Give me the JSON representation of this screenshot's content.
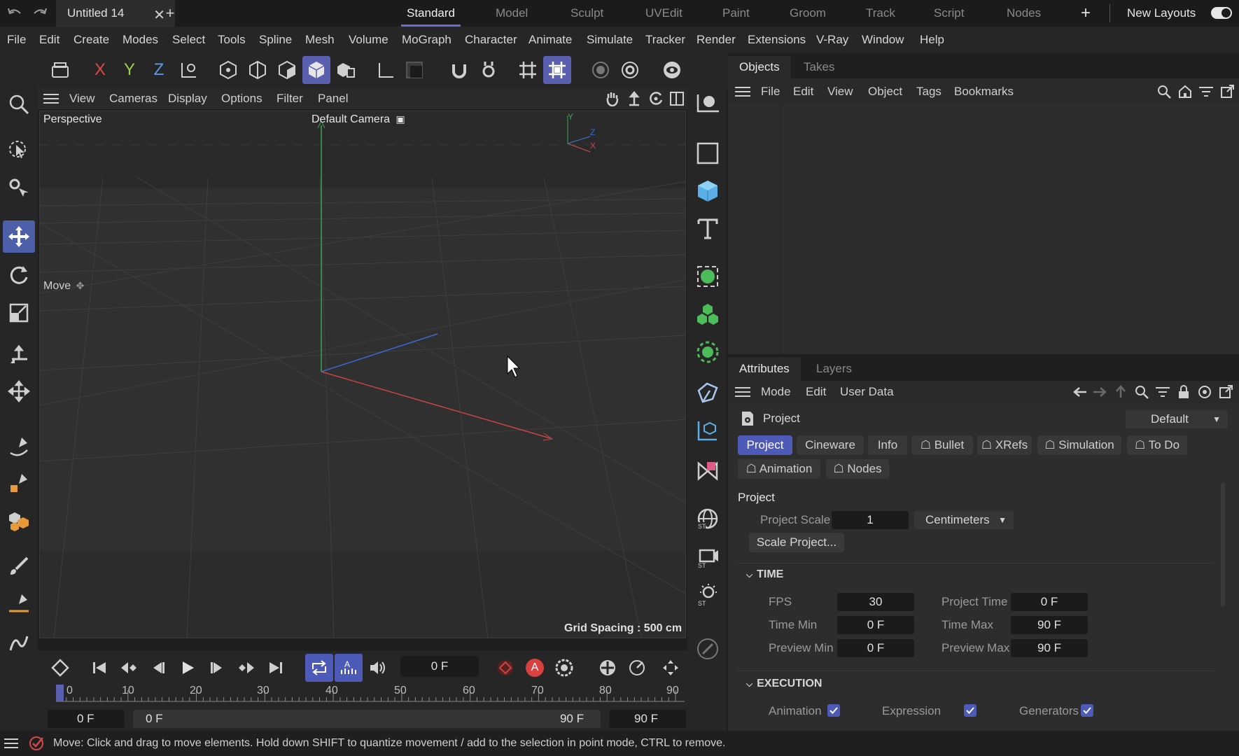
{
  "document": {
    "title": "Untitled 14"
  },
  "layouts": {
    "items": [
      "Standard",
      "Model",
      "Sculpt",
      "UVEdit",
      "Paint",
      "Groom",
      "Track",
      "Script",
      "Nodes"
    ],
    "active": "Standard",
    "new_layouts_label": "New Layouts"
  },
  "menubar": [
    "File",
    "Edit",
    "Create",
    "Modes",
    "Select",
    "Tools",
    "Spline",
    "Mesh",
    "Volume",
    "MoGraph",
    "Character",
    "Animate",
    "Simulate",
    "Tracker",
    "Render",
    "Extensions",
    "V-Ray",
    "Window",
    "Help"
  ],
  "toolbar": {
    "axis_x": "X",
    "axis_y": "Y",
    "axis_z": "Z"
  },
  "viewport": {
    "menu": [
      "View",
      "Cameras",
      "Display",
      "Options",
      "Filter",
      "Panel"
    ],
    "projection": "Perspective",
    "camera": "Default Camera",
    "tool_label": "Move",
    "grid_spacing": "Grid Spacing : 500 cm",
    "axis_y": "Y",
    "axis_z": "Z",
    "axis_x": "X"
  },
  "objects_panel": {
    "tabs": [
      "Objects",
      "Takes"
    ],
    "menu": [
      "File",
      "Edit",
      "View",
      "Object",
      "Tags",
      "Bookmarks"
    ]
  },
  "attributes_panel": {
    "tabs": [
      "Attributes",
      "Layers"
    ],
    "menu": [
      "Mode",
      "Edit",
      "User Data"
    ],
    "object_title": "Project",
    "preset": "Default",
    "pills_row1": [
      "Project",
      "Cineware",
      "Info",
      "Bullet",
      "XRefs",
      "Simulation",
      "To Do"
    ],
    "pills_row2": [
      "Animation",
      "Nodes"
    ],
    "project_section": "Project",
    "project_scale_label": "Project Scale",
    "project_scale_value": "1",
    "project_scale_unit": "Centimeters",
    "scale_project_button": "Scale Project...",
    "time_section": "TIME",
    "fps_label": "FPS",
    "fps_value": "30",
    "project_time_label": "Project Time",
    "project_time_value": "0 F",
    "time_min_label": "Time Min",
    "time_min_value": "0 F",
    "time_max_label": "Time Max",
    "time_max_value": "90 F",
    "preview_min_label": "Preview Min",
    "preview_min_value": "0 F",
    "preview_max_label": "Preview Max",
    "preview_max_value": "90 F",
    "execution_section": "EXECUTION",
    "animation_label": "Animation",
    "expression_label": "Expression",
    "generators_label": "Generators"
  },
  "timeline": {
    "current_frame": "0 F",
    "auto_key_label": "A",
    "ruler_labels": [
      "0",
      "10",
      "20",
      "30",
      "40",
      "50",
      "60",
      "70",
      "80",
      "90"
    ],
    "start_field": "0 F",
    "range_start": "0 F",
    "range_end": "90 F",
    "end_field": "90 F"
  },
  "status": {
    "message": "Move: Click and drag to move elements. Hold down SHIFT to quantize movement / add to the selection in point mode, CTRL to remove."
  },
  "colors": {
    "accent": "#5b5fb0",
    "axis_x": "#d04848",
    "axis_y": "#48b060",
    "axis_z": "#4870d0",
    "green_icon": "#4cbc5a"
  }
}
